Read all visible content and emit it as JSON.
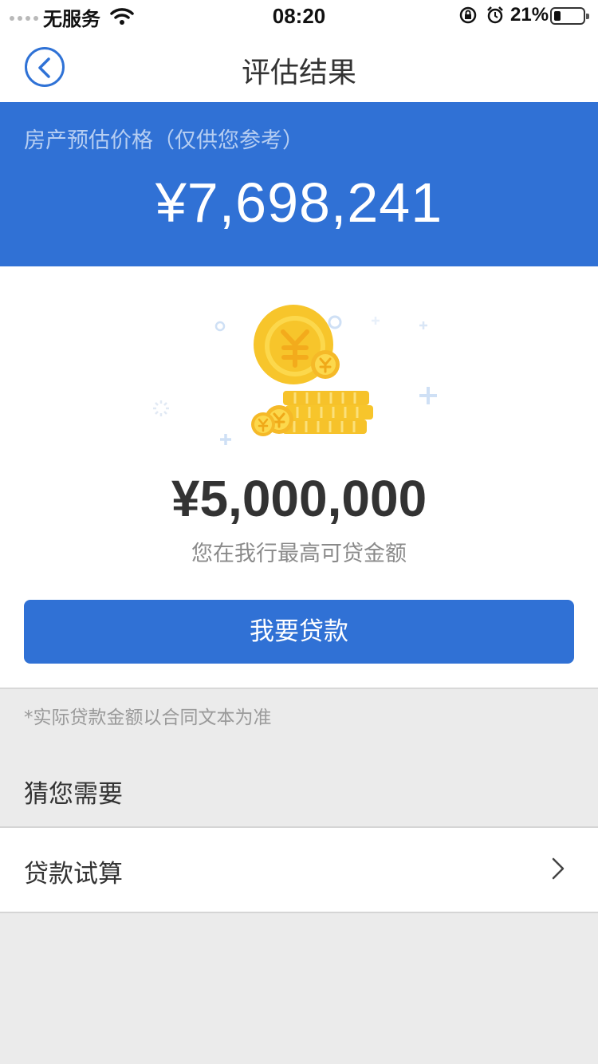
{
  "status_bar": {
    "carrier": "无服务",
    "time": "08:20",
    "battery": "21%"
  },
  "nav": {
    "title": "评估结果"
  },
  "valuation": {
    "label": "房产预估价格（仅供您参考）",
    "price": "¥7,698,241"
  },
  "loan": {
    "amount": "¥5,000,000",
    "caption": "您在我行最高可贷金额",
    "apply_label": "我要贷款",
    "disclaimer": "*实际贷款金额以合同文本为准"
  },
  "suggestions": {
    "title": "猜您需要",
    "items": [
      {
        "label": "贷款试算"
      }
    ]
  },
  "colors": {
    "primary": "#3071d5",
    "coin": "#f7c52b",
    "background": "#ebebeb"
  }
}
